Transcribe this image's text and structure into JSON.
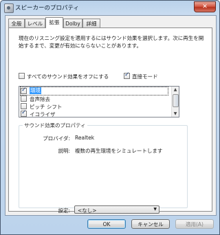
{
  "window": {
    "title": "スピーカーのプロパティ",
    "close_label": "✕"
  },
  "tabs": [
    {
      "label": "全般"
    },
    {
      "label": "レベル"
    },
    {
      "label": "拡張"
    },
    {
      "label": "Dolby"
    },
    {
      "label": "詳細"
    }
  ],
  "active_tab": "拡張",
  "description": "現在のリスニング設定を適用するにはサウンド効果を選択します。次に再生を開始するまで、変更が有効にならないことがあります。",
  "options": {
    "disable_all_label": "すべてのサウンド効果をオフにする",
    "disable_all_checked": false,
    "immediate_mode_label": "直接モード",
    "immediate_mode_checked": true
  },
  "effects": [
    {
      "label": "環境",
      "checked": true,
      "selected": true
    },
    {
      "label": "音声除去",
      "checked": false,
      "selected": false
    },
    {
      "label": "ピッチ シフト",
      "checked": false,
      "selected": false
    },
    {
      "label": "イコライザ",
      "checked": true,
      "selected": false
    }
  ],
  "properties": {
    "group_title": "サウンド効果のプロパティ",
    "provider_label": "プロバイダ:",
    "provider_value": "Realtek",
    "description_label": "説明:",
    "description_value": "複数の再生環境をシミュレートします",
    "setting_label": "設定:",
    "setting_value": "<なし>"
  },
  "buttons": {
    "ok": "OK",
    "cancel": "キャンセル",
    "apply": "適用(A)"
  }
}
